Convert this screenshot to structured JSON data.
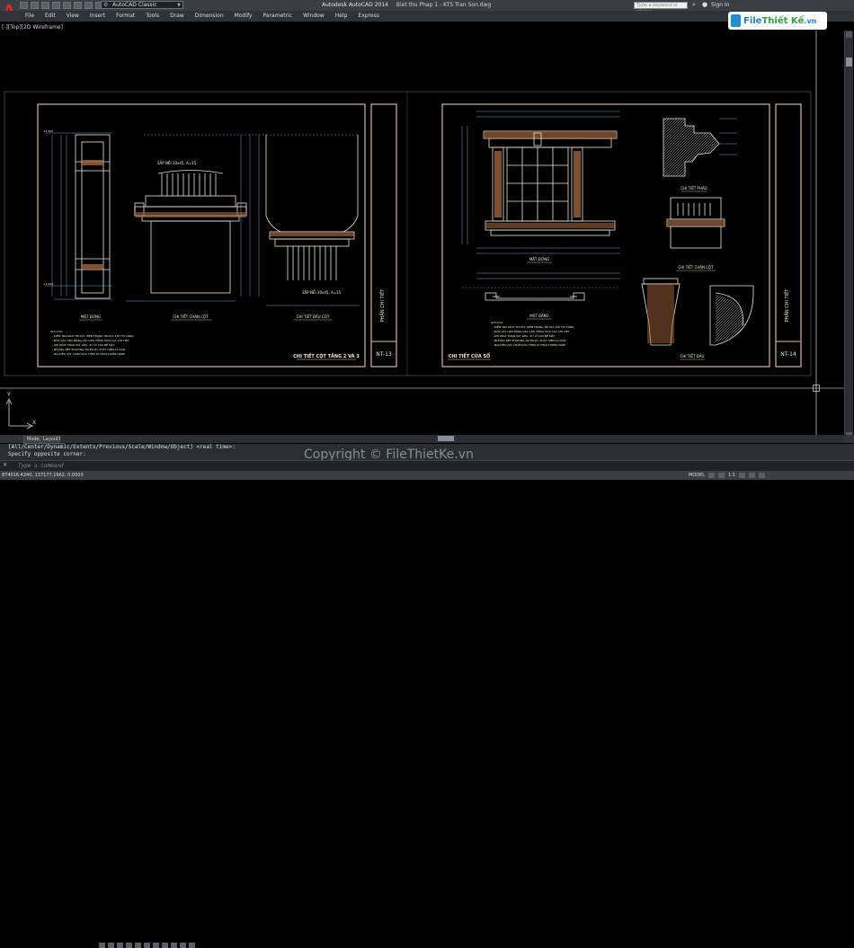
{
  "app": {
    "logo": "A",
    "workspace": "AutoCAD Classic",
    "title": "Autodesk AutoCAD 2014",
    "filename": "Biet thu Phap 1 - KTS Tran Son.dwg",
    "search_placeholder": "Type a keyword or phrase",
    "signin": "Sign In"
  },
  "menu": [
    "File",
    "Edit",
    "View",
    "Insert",
    "Format",
    "Tools",
    "Draw",
    "Dimension",
    "Modify",
    "Parametric",
    "Window",
    "Help",
    "Express"
  ],
  "brand": {
    "part1": "File",
    "part2": "Thiết Kế",
    "part3": ".vn"
  },
  "viewport": {
    "label": "[-][Top][2D Wireframe]"
  },
  "sheets": {
    "left": {
      "side_title": "PHẦN CHI TIẾT",
      "sheet_no": "NT-13",
      "title": "CHI TIẾT CỘT TẦNG 2 VÀ 3",
      "labels": [
        "MẶT ĐỨNG",
        "CHI TIẾT CHÂN CỘT",
        "CHI TIẾT ĐẦU CỘT"
      ],
      "note_top": "SẮP NỀI 20x45, A=15",
      "note_bottom": "SẮP NỀI 30x45, A=15",
      "notes_title": "GHI CHÚ:",
      "notes": [
        "- KIỂM TRA KÍCH THƯỚC HIỆN TRẠNG TRƯỚC KHI THI CÔNG",
        "- ĐỘT VẬT LIỆU BẰNG VẬT LIỆU TỔNG HỢP CÁC CHI TIẾT",
        "- KHI PHÁT TRÁN VẬT LIỆU, XỬ LÝ CÁC BỀ MẶT",
        "- NHỮNG NÉT PHƯƠNG ÁN ĐƯỢC XUẤT HIỆN LÀ DẦN",
        "- NGUYÊN VẬT CHĂM SÓC THEO KĨ THUẬT HIỆN HÀNH"
      ]
    },
    "right": {
      "side_title": "PHẦN CHI TIẾT",
      "sheet_no": "NT-14",
      "title": "CHI TIẾT CỬA SỔ",
      "labels": [
        "MẶT ĐỨNG",
        "MẶT BẰNG",
        "CHI TIẾT PHÀO",
        "CHI TIẾT CHÂN CỘT",
        "CHI TIẾT ĐẦU"
      ],
      "notes_title": "GHI CHÚ:",
      "notes": [
        "- KIỂM TRA KÍCH THƯỚC HIỆN TRẠNG TRƯỚC KHI THI CÔNG",
        "- ĐỘT VẬT LIỆU BẰNG VẬT LIỆU TỔNG HỢP CÁC CHI TIẾT",
        "- KHI PHÁT TRÁN VẬT LIỆU, XỬ LÝ CÁC BỀ MẶT",
        "- NHỮNG NÉT PHƯƠNG ÁN ĐƯỢC XUẤT HIỆN LÀ DẦN",
        "- NGUYÊN VẬT CHĂM SÓC THEO KĨ THUẬT HIỆN HÀNH"
      ]
    }
  },
  "ucs": {
    "x": "X",
    "y": "Y"
  },
  "tabs": [
    "Model",
    "Layout1"
  ],
  "command": {
    "history": [
      "[All/Center/Dynamic/Extents/Previous/Scale/Window/Object] <real time>:",
      "Specify opposite corner:"
    ],
    "placeholder": "Type a command"
  },
  "watermark": "Copyright © FileThietKe.vn",
  "status": {
    "coords": "874016.4240, 137177.1962, 0.0000",
    "model": "MODEL",
    "scale": "1:1"
  },
  "colors": {
    "frame": "#d9b896",
    "lines": "#f2e6d0",
    "text": "#f4e9c8",
    "dim": "#8fc7ff",
    "brown": "#a0643c"
  }
}
